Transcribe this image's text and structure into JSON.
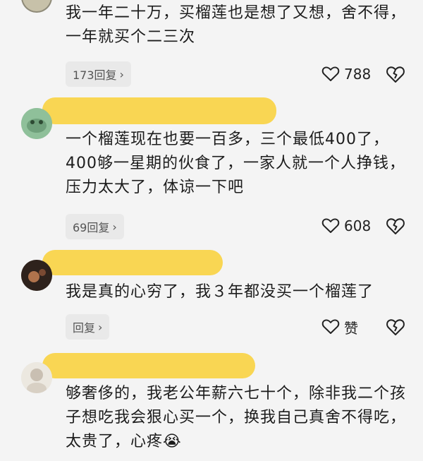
{
  "comments": [
    {
      "body": "我一年二十万，买榴莲也是想了又想，舍不得，一年就买个二三次",
      "reply_label": "173回复",
      "likes": "788"
    },
    {
      "body": "一个榴莲现在也要一百多，三个最低400了，400够一星期的伙食了，一家人就一个人挣钱，压力太大了，体谅一下吧",
      "reply_label": "69回复",
      "likes": "608"
    },
    {
      "body": "我是真的心穷了，我３年都没买一个榴莲了",
      "reply_label": "回复",
      "likes": "赞"
    },
    {
      "body": "够奢侈的，我老公年薪六七十个，除非我二个孩子想吃我会狠心买一个，换我自己真舍不得吃，太贵了，心疼",
      "emoji": "😭"
    }
  ],
  "colors": {
    "highlight": "#f9d44a",
    "reply_bg": "#e9e9e9",
    "page_bg": "#f4f4f4"
  },
  "icons": [
    "heart-outline-icon",
    "broken-heart-icon",
    "chevron-right-icon",
    "crying-emoji-icon"
  ]
}
